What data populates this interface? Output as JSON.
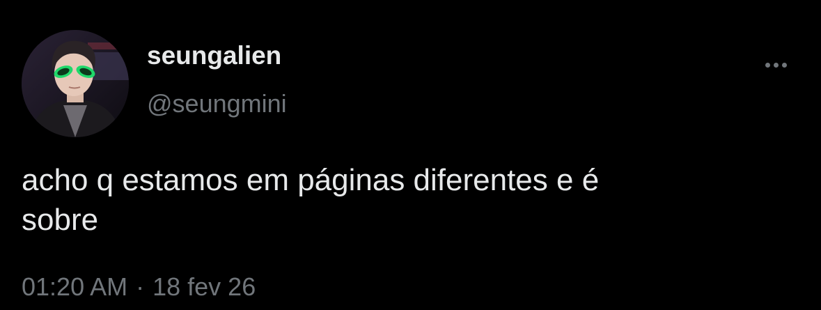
{
  "user": {
    "display_name": "seungalien",
    "handle": "@seungmini",
    "avatar_icon": "profile-photo-alien-glasses"
  },
  "tweet": {
    "text": "acho q estamos em páginas diferentes e é\nsobre",
    "time": "01:20 AM",
    "separator": "·",
    "date": "18 fev 26"
  },
  "menu": {
    "icon": "more-horizontal-icon"
  },
  "colors": {
    "background": "#000000",
    "primary_text": "#e7e9ea",
    "secondary_text": "#71767b"
  }
}
